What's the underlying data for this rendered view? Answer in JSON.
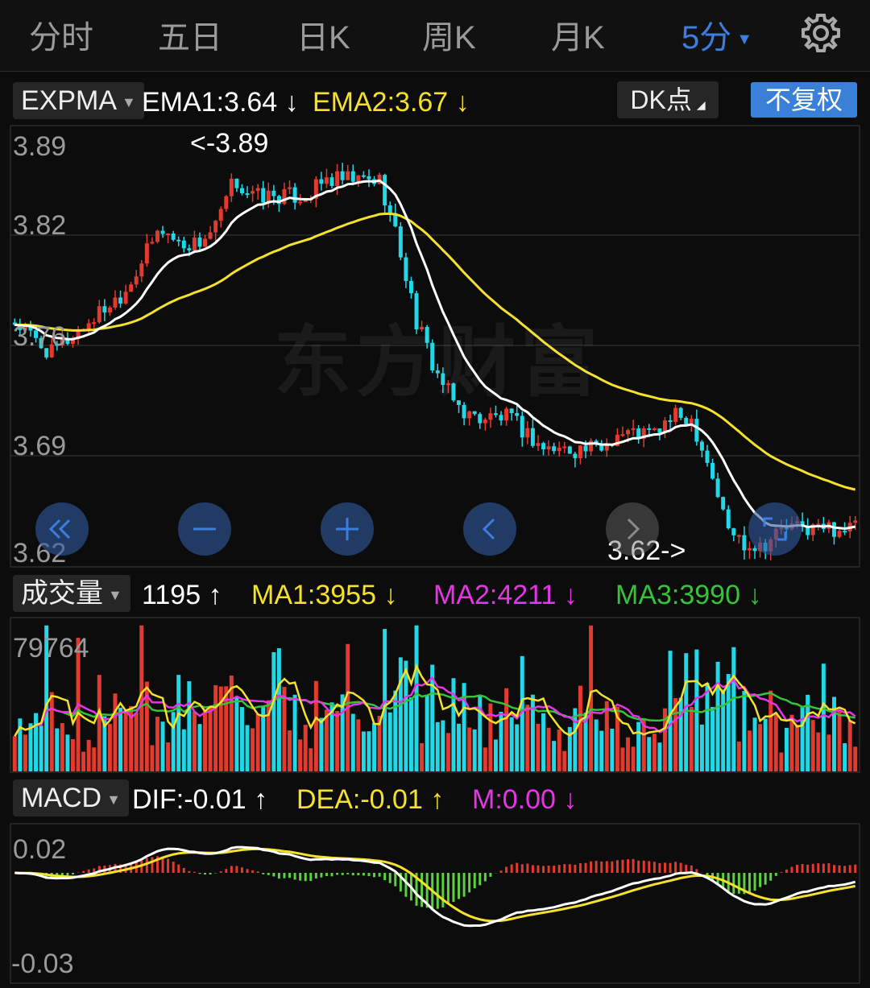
{
  "tabs": [
    {
      "label": "分时",
      "active": false
    },
    {
      "label": "五日",
      "active": false
    },
    {
      "label": "日K",
      "active": false
    },
    {
      "label": "周K",
      "active": false
    },
    {
      "label": "月K",
      "active": false
    },
    {
      "label": "5分",
      "active": true
    }
  ],
  "settings_icon": "gear-icon",
  "colors": {
    "up": "#e23a2e",
    "down": "#22d7e6",
    "accent": "#3c7de0",
    "ema1": "#ffffff",
    "ema2": "#f5e12a",
    "ma1": "#f5e12a",
    "ma2": "#e535e5",
    "ma3": "#35c33a",
    "green_bar": "#5bd13c"
  },
  "main_panel": {
    "selector": "EXPMA",
    "ema1": "EMA1:3.64 ↓",
    "ema2": "EMA2:3.67 ↓",
    "dk_button": "DK点",
    "adjust_button": "不复权",
    "y_labels": [
      "3.89",
      "3.82",
      "3.76",
      "3.69",
      "3.62"
    ],
    "max_marker": "<-3.89",
    "min_marker": "3.62->",
    "watermark": "东方财富"
  },
  "volume_panel": {
    "selector": "成交量",
    "vol": "1195 ↑",
    "ma1": "MA1:3955 ↓",
    "ma2": "MA2:4211 ↓",
    "ma3": "MA3:3990 ↓",
    "y_label": "79764"
  },
  "macd_panel": {
    "selector": "MACD",
    "dif": "DIF:-0.01 ↑",
    "dea": "DEA:-0.01 ↑",
    "m": "M:0.00 ↓",
    "y_labels": [
      "0.02",
      "-0.03"
    ]
  },
  "zoom_controls": [
    {
      "icon": "double-left-icon"
    },
    {
      "icon": "zoom-out-icon"
    },
    {
      "icon": "zoom-in-icon"
    },
    {
      "icon": "left-icon"
    },
    {
      "icon": "right-icon"
    },
    {
      "icon": "fullscreen-icon"
    }
  ],
  "chart_data": {
    "type": "candlestick",
    "y_range": [
      3.62,
      3.89
    ],
    "series": [
      {
        "name": "EMA1"
      },
      {
        "name": "EMA2"
      }
    ],
    "close_path": [
      3.77,
      3.76,
      3.75,
      3.76,
      3.77,
      3.78,
      3.79,
      3.81,
      3.83,
      3.82,
      3.82,
      3.83,
      3.86,
      3.85,
      3.85,
      3.85,
      3.85,
      3.86,
      3.86,
      3.86,
      3.86,
      3.82,
      3.77,
      3.74,
      3.72,
      3.71,
      3.71,
      3.71,
      3.7,
      3.69,
      3.69,
      3.69,
      3.69,
      3.7,
      3.7,
      3.7,
      3.71,
      3.71,
      3.68,
      3.64,
      3.63,
      3.63,
      3.64,
      3.64,
      3.64,
      3.64,
      3.64
    ]
  }
}
